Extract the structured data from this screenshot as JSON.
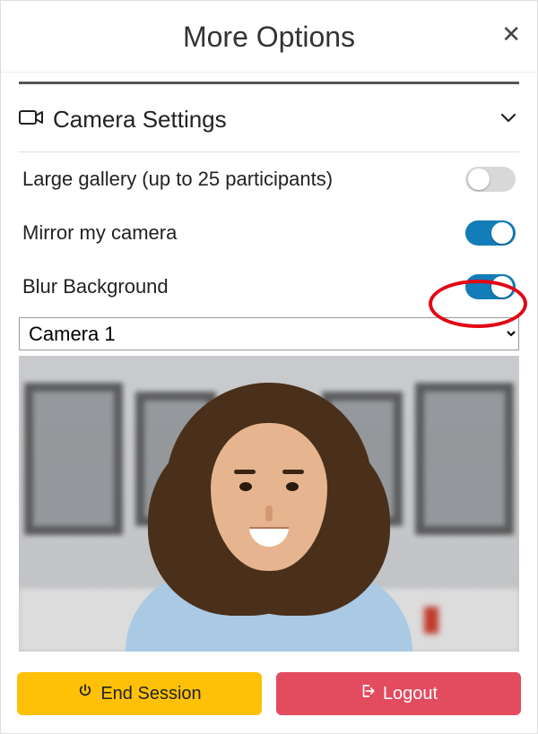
{
  "header": {
    "title": "More Options"
  },
  "section": {
    "title": "Camera Settings"
  },
  "rows": {
    "large_gallery": {
      "label": "Large gallery (up to 25 participants)",
      "on": false
    },
    "mirror": {
      "label": "Mirror my camera",
      "on": true
    },
    "blur": {
      "label": "Blur Background",
      "on": true,
      "highlighted": true
    }
  },
  "camera_select": {
    "options": [
      "Camera 1"
    ],
    "value": "Camera 1"
  },
  "footer": {
    "end_session": "End Session",
    "logout": "Logout"
  }
}
